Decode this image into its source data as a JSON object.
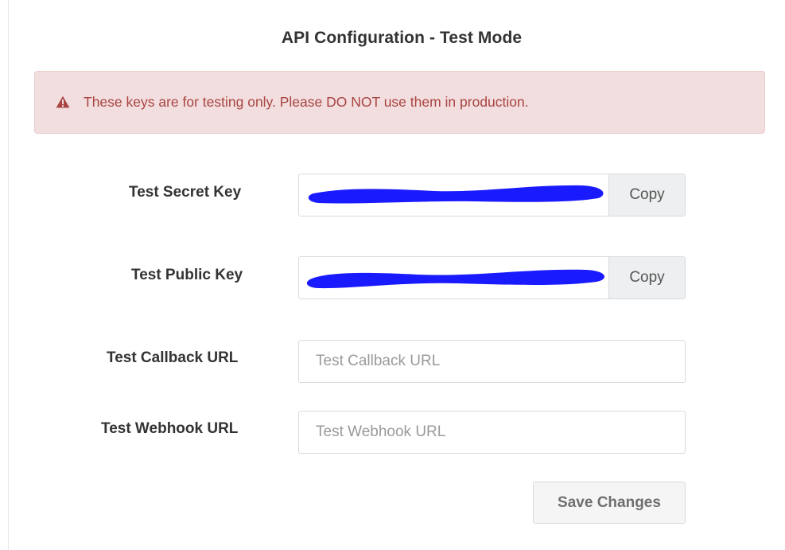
{
  "page": {
    "title": "API Configuration - Test Mode"
  },
  "alert": {
    "icon": "warning-triangle-icon",
    "message": "These keys are for testing only. Please DO NOT use them in production."
  },
  "form": {
    "secret_key": {
      "label": "Test Secret Key",
      "value_redacted": true,
      "copy_label": "Copy"
    },
    "public_key": {
      "label": "Test Public Key",
      "value_redacted": true,
      "copy_label": "Copy"
    },
    "callback_url": {
      "label": "Test Callback URL",
      "value": "",
      "placeholder": "Test Callback URL"
    },
    "webhook_url": {
      "label": "Test Webhook URL",
      "value": "",
      "placeholder": "Test Webhook URL"
    },
    "save_label": "Save Changes"
  },
  "colors": {
    "alert_background": "#f2dede",
    "alert_text": "#a94442",
    "redaction": "#1a1aff"
  }
}
